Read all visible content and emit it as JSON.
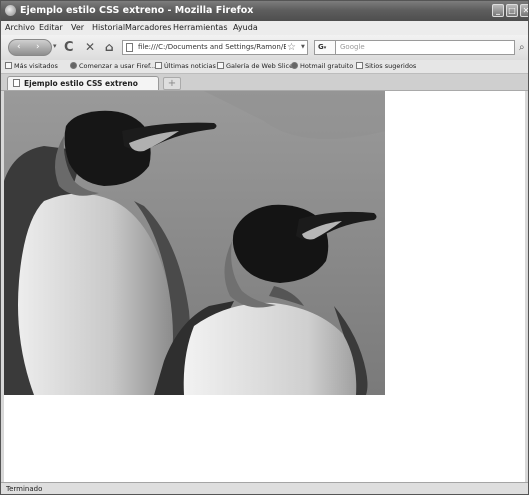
{
  "window": {
    "title": "Ejemplo estilo CSS extreno - Mozilla Firefox",
    "icon": "firefox-icon"
  },
  "menu": {
    "items": [
      "Archivo",
      "Editar",
      "Ver",
      "Historial",
      "Marcadores",
      "Herramientas",
      "Ayuda"
    ]
  },
  "navbar": {
    "back_glyph": "‹",
    "forward_glyph": "›",
    "reload_glyph": "C",
    "stop_glyph": "✕",
    "home_glyph": "⌂",
    "url": "file:///C:/Documents and Settings/Ramon/Escrit",
    "star_glyph": "☆",
    "search_engine_label": "G",
    "search_placeholder": "Google",
    "search_go_glyph": "⌕"
  },
  "bookmarks": {
    "items": [
      {
        "label": "Más visitados",
        "icon": "bookmarks-star-icon"
      },
      {
        "label": "Comenzar a usar Firef...",
        "icon": "firefox-icon"
      },
      {
        "label": "Últimas noticias",
        "icon": "rss-feed-icon"
      },
      {
        "label": "Galería de Web Slice",
        "icon": "web-slice-icon"
      },
      {
        "label": "Hotmail gratuito",
        "icon": "msn-icon"
      },
      {
        "label": "Sitios sugeridos",
        "icon": "page-icon"
      }
    ]
  },
  "tabs": {
    "items": [
      {
        "label": "Ejemplo estilo CSS extreno"
      }
    ],
    "new_tab_glyph": "+"
  },
  "content": {
    "image_subject": "two king penguins"
  },
  "status": {
    "text": "Terminado"
  }
}
